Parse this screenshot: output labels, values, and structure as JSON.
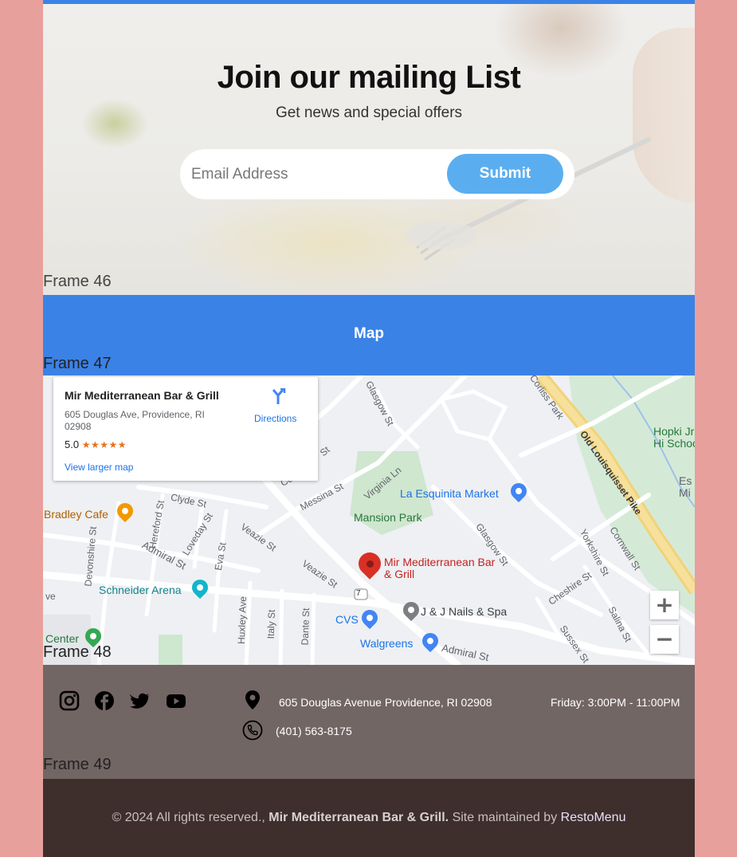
{
  "mailing": {
    "title": "Join our mailing List",
    "subtitle": "Get news and special offers",
    "email_placeholder": "Email Address",
    "submit_label": "Submit",
    "frame_label": "Frame 46"
  },
  "map_section": {
    "title": "Map",
    "frame_label": "Frame 47"
  },
  "map": {
    "frame_label": "Frame 48",
    "card": {
      "name": "Mir Mediterranean Bar & Grill",
      "address": "605 Douglas Ave, Providence, RI 02908",
      "rating": "5.0",
      "stars": "★★★★★",
      "directions_label": "Directions",
      "larger_map_label": "View larger map"
    },
    "zoom_in": "+",
    "zoom_out": "−",
    "places": {
      "la_esquinita": "La Esquinita Market",
      "mansion_park": "Mansion Park",
      "mir_marker": "Mir Mediterranean Bar & Grill",
      "jj_nails": "J & J Nails & Spa",
      "cvs": "CVS",
      "walgreens": "Walgreens",
      "schneider": "Schneider Arena",
      "bradley": "Bradley Cafe",
      "center": "Center",
      "hopkins": "Hopki Jr Hi School",
      "es_mi": "Es Mi"
    },
    "streets": {
      "glasgow1": "Glasgow St",
      "glasgow2": "Glasgow St",
      "corliss": "Corliss Park",
      "old_louisquisset": "Old Louisquisset Pike",
      "virginia": "Virginia Ln",
      "messina": "Messina St",
      "clyde": "Clyde St",
      "hereford": "Hereford St",
      "devonshire": "Devonshire St",
      "admiral1": "Admiral St",
      "admiral2": "Admiral St",
      "loveday": "Loveday St",
      "eva": "Eva St",
      "veazie1": "Veazie St",
      "veazie2": "Veazie St",
      "huxley": "Huxley Ave",
      "italy": "Italy St",
      "dante": "Dante St",
      "yorkshire": "Yorkshire St",
      "cornwall": "Cornwall St",
      "cheshire": "Cheshire St",
      "salina": "Salina St",
      "sussex": "Sussex St",
      "route": "7",
      "st_fragment": "St",
      "co_fragment": "Co",
      "ve_fragment": "ve"
    }
  },
  "footer": {
    "address": "605 Douglas Avenue Providence, RI 02908",
    "phone": "(401) 563-8175",
    "hours": "Friday: 3:00PM - 11:00PM",
    "frame_label": "Frame 49",
    "social": [
      "instagram-icon",
      "facebook-icon",
      "twitter-icon",
      "youtube-icon"
    ]
  },
  "copyright": {
    "prefix": "© 2024 All rights reserved., ",
    "business": "Mir Mediterranean Bar & Grill.",
    "middle": " Site maintained by ",
    "link": "RestoMenu"
  },
  "colors": {
    "page_background": "#e8a09c",
    "accent_blue": "#3b82e6",
    "submit_blue": "#5aaef0",
    "footer_info_bg": "#726664",
    "copyright_bg": "#3e2f2d",
    "map_marker": "#d93025"
  }
}
